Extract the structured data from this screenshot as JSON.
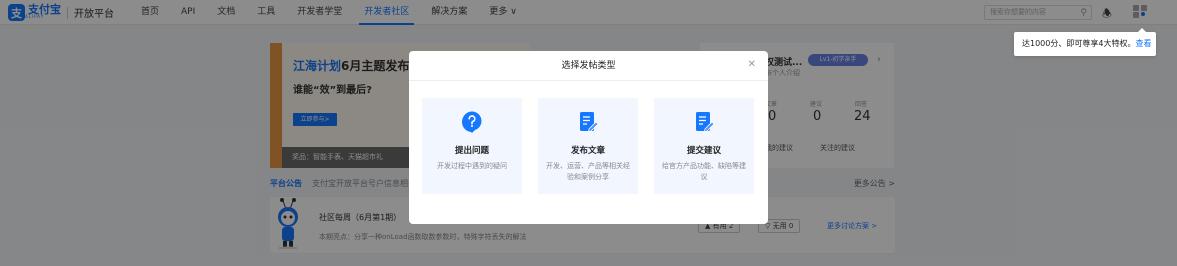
{
  "logo": {
    "cn": "支付宝",
    "en": "ALIPAY",
    "title": "开放平台"
  },
  "nav": [
    {
      "label": "首页"
    },
    {
      "label": "API"
    },
    {
      "label": "文档"
    },
    {
      "label": "工具"
    },
    {
      "label": "开发者学堂"
    },
    {
      "label": "开发者社区"
    },
    {
      "label": "解决方案"
    },
    {
      "label": "更多 ∨"
    }
  ],
  "search": {
    "placeholder": "搜索你想要的内容"
  },
  "tooltip": {
    "text": "达1000分、即可尊享4大特权。",
    "link": "查看"
  },
  "banner": {
    "title_blue": "江海计划",
    "title_dark": "6月主题发布",
    "subtitle": "谁能“效”到最后?",
    "button": "立即参与>",
    "footer": "奖品：智能手表、天猫超市礼"
  },
  "profile": {
    "name": "权测试...",
    "badge": "Lv1-初学亲手",
    "intro": "布个人介绍",
    "stats": [
      {
        "label": "文章",
        "value": "0"
      },
      {
        "label": "建议",
        "value": "0"
      },
      {
        "label": "回答",
        "value": "24"
      }
    ],
    "links": [
      "我的建议",
      "关注的建议"
    ]
  },
  "notice": {
    "tag": "平台公告",
    "text": "支付宝开放平台号户信息相关",
    "more": "更多公告 >"
  },
  "weekly": {
    "title": "社区每周（6月第1期）",
    "desc": "本期亮点：分享一种onLoad函数取数参数时，特殊字符丢失的解法",
    "like": "有用 2",
    "useless": "无用 0",
    "more": "更多讨论方案 >"
  },
  "modal": {
    "title": "选择发帖类型",
    "options": [
      {
        "title": "提出问题",
        "desc": "开发过程中遇到的疑问",
        "icon": "question-icon"
      },
      {
        "title": "发布文章",
        "desc": "开发、运营、产品等相关经验和案例分享",
        "icon": "article-edit-icon"
      },
      {
        "title": "提交建议",
        "desc": "给官方产品功能、缺陷等建议",
        "icon": "suggestion-edit-icon"
      }
    ]
  },
  "colors": {
    "accent": "#1677ff",
    "banner_orange": "#e89845",
    "badge": "#6a82e6"
  }
}
